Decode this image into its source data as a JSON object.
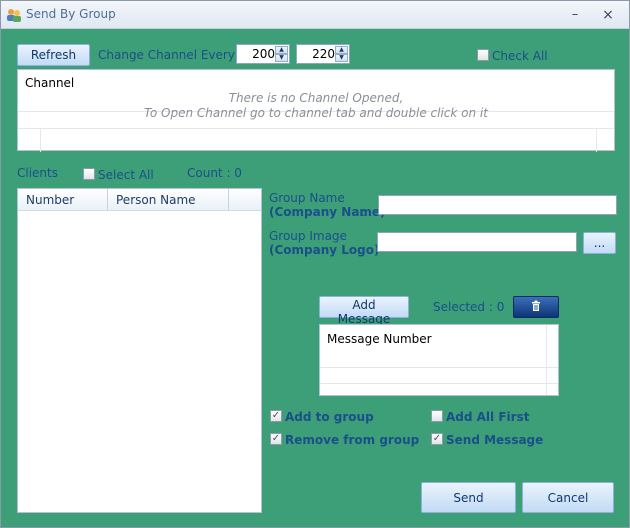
{
  "window": {
    "title": "Send By Group",
    "minimize": "–",
    "close": "×"
  },
  "channels": {
    "refresh_label": "Refresh",
    "change_every_label": "Change Channel Every",
    "interval_min": "200",
    "interval_max": "220",
    "check_all_label": "Check All",
    "column_header": "Channel",
    "empty_line1": "There is no Channel Opened,",
    "empty_line2": "To Open Channel go to channel tab and double click on it"
  },
  "clients": {
    "label": "Clients",
    "select_all_label": "Select All",
    "count_label": "Count : 0",
    "columns": [
      "Number",
      "Person Name"
    ]
  },
  "group": {
    "name_label_line1": "Group Name",
    "name_label_line2": "(Company Name)",
    "name_colon": ":",
    "image_label_line1": "Group Image",
    "image_label_line2": "(Company Logo)",
    "image_colon": ":",
    "browse_label": "..."
  },
  "messages": {
    "add_label": "Add Message",
    "selected_label": "Selected : 0",
    "delete_icon": "trash-icon",
    "column_header": "Message Number"
  },
  "options": {
    "add_to_group": "Add to group",
    "add_to_group_checked": true,
    "add_all_first": "Add All First",
    "add_all_first_checked": false,
    "remove_from_group": "Remove from group",
    "remove_from_group_checked": true,
    "send_message": "Send Message",
    "send_message_checked": true
  },
  "actions": {
    "send_label": "Send",
    "cancel_label": "Cancel"
  },
  "colors": {
    "background": "#3d9f78",
    "label": "#1a4f8a",
    "button": "#c2dbf5"
  }
}
